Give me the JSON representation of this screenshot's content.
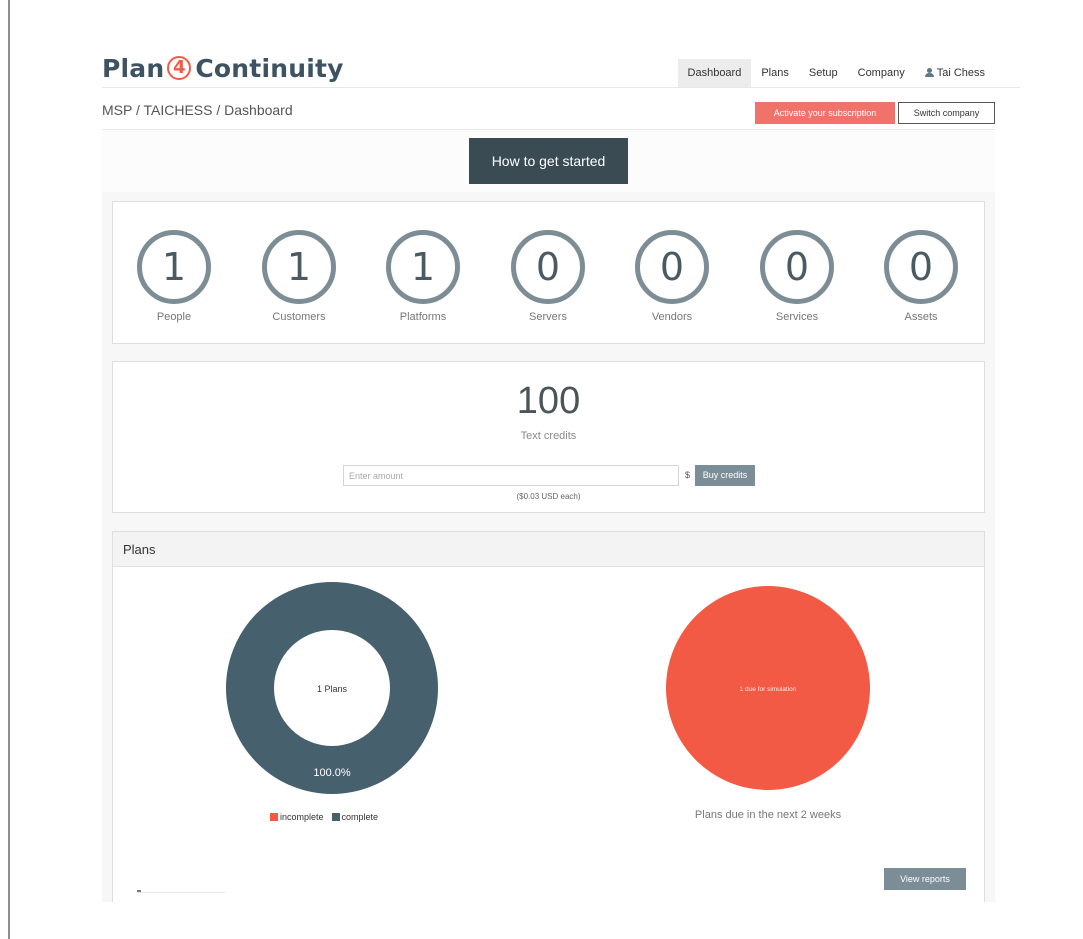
{
  "brand": {
    "part1": "Plan",
    "part2": "4",
    "part3": "Continuity"
  },
  "nav": {
    "items": [
      {
        "label": "Dashboard",
        "active": true
      },
      {
        "label": "Plans"
      },
      {
        "label": "Setup"
      },
      {
        "label": "Company"
      }
    ],
    "user": "Tai Chess",
    "user_icon": "user-icon"
  },
  "breadcrumb": "MSP / TAICHESS / Dashboard",
  "actions": {
    "activate": "Activate your subscription",
    "switch": "Switch company"
  },
  "getting_started": "How to get started",
  "counters": [
    {
      "value": "1",
      "label": "People"
    },
    {
      "value": "1",
      "label": "Customers"
    },
    {
      "value": "1",
      "label": "Platforms"
    },
    {
      "value": "0",
      "label": "Servers"
    },
    {
      "value": "0",
      "label": "Vendors"
    },
    {
      "value": "0",
      "label": "Services"
    },
    {
      "value": "0",
      "label": "Assets"
    }
  ],
  "credits": {
    "value": "100",
    "label": "Text credits",
    "input_placeholder": "Enter amount",
    "currency": "$",
    "buy_label": "Buy credits",
    "price_note": "($0.03 USD each)"
  },
  "plans": {
    "title": "Plans",
    "view_reports": "View reports",
    "due_caption": "Plans due in the next 2 weeks"
  },
  "colors": {
    "complete": "#46606e",
    "incomplete": "#f35a45",
    "accent": "#f35a45"
  },
  "chart_data": [
    {
      "type": "pie",
      "variant": "donut",
      "center_label": "1 Plans",
      "slices": [
        {
          "label": "incomplete",
          "value": 0,
          "color": "#f35a45"
        },
        {
          "label": "complete",
          "value": 100,
          "color": "#46606e"
        }
      ],
      "data_labels": [
        "100.0%"
      ],
      "legend": [
        "incomplete",
        "complete"
      ],
      "legend_position": "bottom"
    },
    {
      "type": "pie",
      "slices": [
        {
          "label": "1 due for simulation",
          "value": 1,
          "color": "#f35a45"
        }
      ],
      "caption": "Plans due in the next 2 weeks"
    }
  ]
}
